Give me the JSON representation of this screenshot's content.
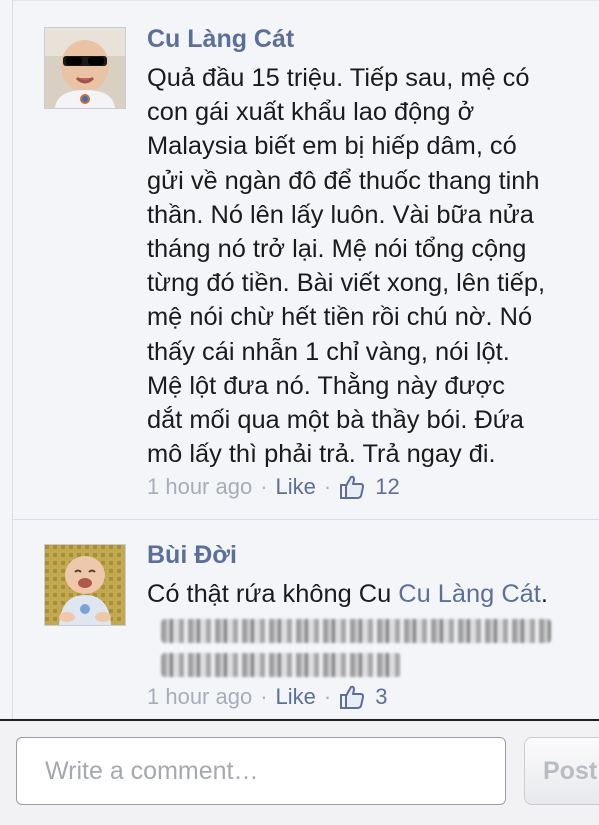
{
  "comments": [
    {
      "author": "Cu Làng Cát",
      "lines": [
        "Quả đầu 15 triệu. Tiếp sau, mệ có",
        "con gái xuất khẩu lao động ở",
        "Malaysia biết em bị hiếp dâm, có",
        "gửi về ngàn đô để thuốc thang tinh",
        "thần. Nó lên lấy luôn. Vài bữa nửa",
        "tháng nó trở lại. Mệ nói tổng cộng",
        "từng đó tiền. Bài viết xong, lên tiếp,",
        "mệ nói chừ hết tiền rồi chú nờ. Nó",
        "thấy cái nhẫn 1 chỉ vàng, nói lột.",
        "Mệ lột đưa nó. Thằng này được",
        "dắt mối qua một bà thầy bói. Đứa",
        "mô lấy thì phải trả. Trả ngay đi."
      ],
      "time": "1 hour ago",
      "like_label": "Like",
      "likes": "12",
      "separator": "·"
    },
    {
      "author": "Bùi Đời",
      "text_prefix": "Có thật rứa không Cu ",
      "mention": "Cu Làng Cát",
      "text_suffix": ".",
      "time": "1 hour ago",
      "like_label": "Like",
      "likes": "3",
      "separator": "·"
    }
  ],
  "composer": {
    "placeholder": "Write a comment…",
    "post_label": "Post"
  },
  "colors": {
    "link": "#5b6f98",
    "meta": "#a7adb8",
    "feed_bg": "#f4f5f8",
    "text": "#1b1b1b"
  },
  "icons": {
    "like": "thumbs-up-icon",
    "avatar1": "baby-with-sunglasses",
    "avatar2": "laughing-baby"
  }
}
